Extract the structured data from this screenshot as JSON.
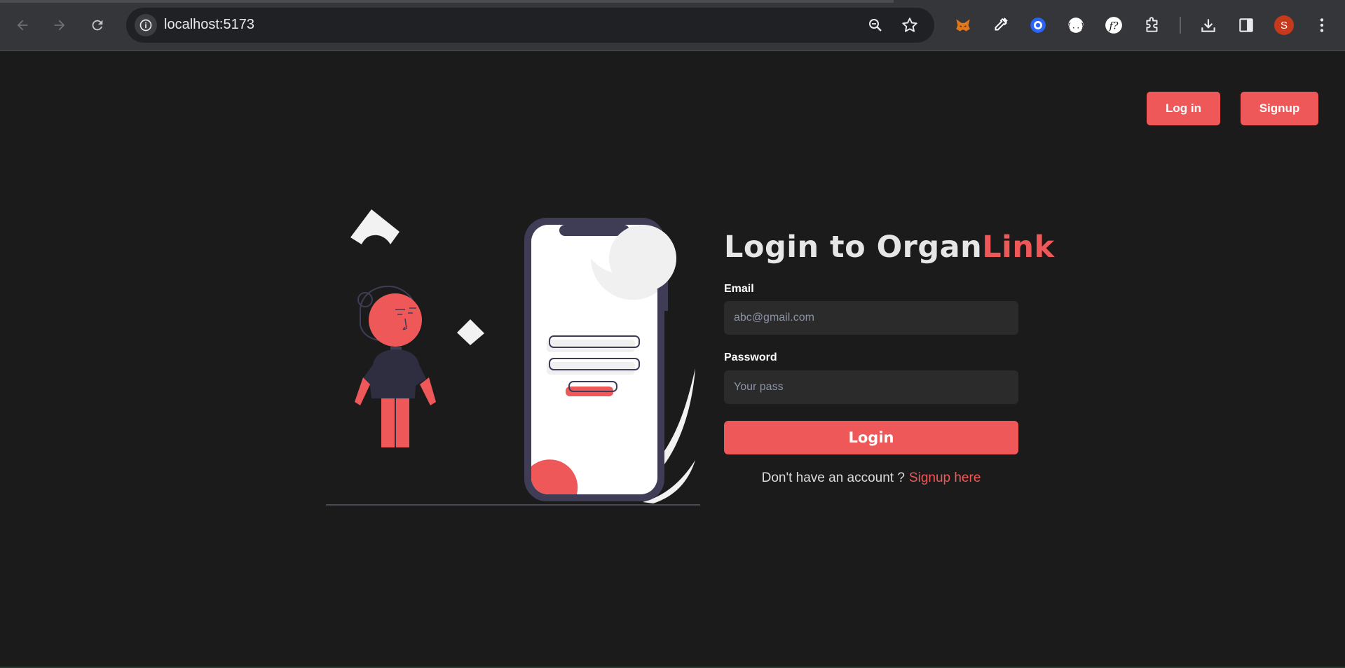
{
  "browser": {
    "url": "localhost:5173",
    "profile_initial": "S",
    "icons": [
      "back-icon",
      "forward-icon",
      "reload-icon",
      "site-info-icon",
      "zoom-icon",
      "bookmark-star-icon",
      "metamask-fox-icon",
      "eyedropper-icon",
      "circle-extension-icon",
      "json-extension-icon",
      "fonts-extension-icon",
      "extensions-puzzle-icon",
      "download-icon",
      "side-panel-icon",
      "menu-icon"
    ]
  },
  "header": {
    "login_label": "Log in",
    "signup_label": "Signup"
  },
  "form": {
    "title_main": "Login to Organ",
    "title_accent": "Link",
    "email_label": "Email",
    "email_placeholder": "abc@gmail.com",
    "email_value": "",
    "password_label": "Password",
    "password_placeholder": "Your pass",
    "password_value": "",
    "submit_label": "Login",
    "signup_prompt": "Don't have an account ?",
    "signup_link": "Signup here"
  },
  "colors": {
    "accent": "#ef5859",
    "background": "#1b1b1b",
    "input_bg": "#2b2b2b",
    "figure_dark": "#2f2e41"
  }
}
